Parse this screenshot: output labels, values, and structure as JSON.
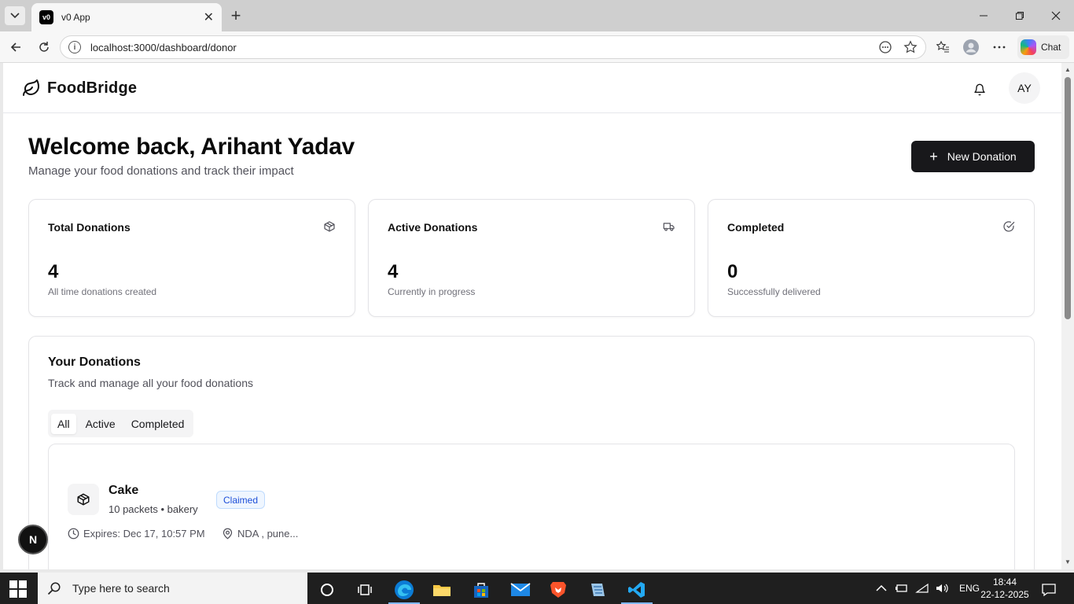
{
  "browser": {
    "tab_title": "v0 App",
    "favicon_text": "v0",
    "url": "localhost:3000/dashboard/donor",
    "chat_label": "Chat"
  },
  "app": {
    "brand": "FoodBridge",
    "avatar_initials": "AY"
  },
  "welcome": {
    "title": "Welcome back, Arihant Yadav",
    "subtitle": "Manage your food donations and track their impact",
    "new_donation_label": "New Donation"
  },
  "stats": [
    {
      "title": "Total Donations",
      "value": "4",
      "desc": "All time donations created",
      "icon": "package-icon"
    },
    {
      "title": "Active Donations",
      "value": "4",
      "desc": "Currently in progress",
      "icon": "truck-icon"
    },
    {
      "title": "Completed",
      "value": "0",
      "desc": "Successfully delivered",
      "icon": "check-circle-icon"
    }
  ],
  "donations": {
    "title": "Your Donations",
    "subtitle": "Track and manage all your food donations",
    "tabs": [
      "All",
      "Active",
      "Completed"
    ],
    "active_tab": "All",
    "items": [
      {
        "name": "Cake",
        "meta": "10 packets • bakery",
        "status": "Claimed",
        "expires": "Expires: Dec 17, 10:57 PM",
        "location": "NDA , pune..."
      }
    ]
  },
  "next_badge": "N",
  "taskbar": {
    "search_placeholder": "Type here to search",
    "language": "ENG",
    "time": "18:44",
    "date": "22-12-2025"
  },
  "colors": {
    "primary_button": "#18181b",
    "badge_bg": "#eff6ff",
    "badge_text": "#1d4ed8"
  }
}
